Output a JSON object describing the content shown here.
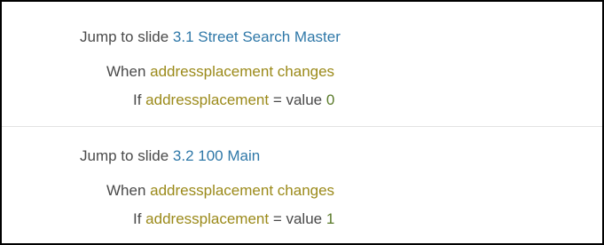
{
  "colors": {
    "text": "#4a4a4a",
    "slide_link": "#2f78a8",
    "variable": "#9b8a1a",
    "value_number": "#5a7a2a",
    "divider": "#e3e3e3",
    "frame_border": "#000000"
  },
  "actions": [
    {
      "jump_prefix": "Jump to slide ",
      "slide": "3.1 Street Search Master",
      "when_prefix": "When ",
      "when_variable": "addressplacement",
      "when_event": " changes",
      "if_prefix": "If ",
      "if_variable": "addressplacement",
      "if_operator": " = value ",
      "if_value": "0"
    },
    {
      "jump_prefix": "Jump to slide ",
      "slide": "3.2 100 Main",
      "when_prefix": "When ",
      "when_variable": "addressplacement",
      "when_event": " changes",
      "if_prefix": "If ",
      "if_variable": "addressplacement",
      "if_operator": " = value ",
      "if_value": "1"
    }
  ]
}
